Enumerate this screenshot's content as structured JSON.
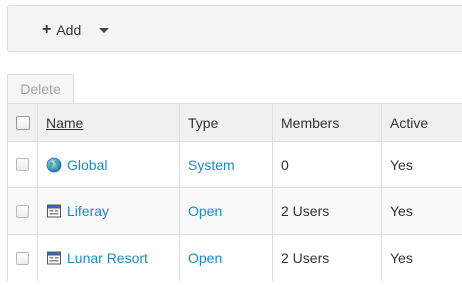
{
  "toolbar": {
    "add_label": "Add"
  },
  "actions": {
    "delete_label": "Delete"
  },
  "table": {
    "headers": {
      "name": "Name",
      "type": "Type",
      "members": "Members",
      "active": "Active"
    },
    "rows": [
      {
        "name": "Global",
        "icon": "globe-icon",
        "type": "System",
        "members": "0",
        "active": "Yes"
      },
      {
        "name": "Liferay",
        "icon": "site-icon",
        "type": "Open",
        "members": "2 Users",
        "active": "Yes"
      },
      {
        "name": "Lunar Resort",
        "icon": "site-icon",
        "type": "Open",
        "members": "2 Users",
        "active": "Yes"
      }
    ]
  },
  "colors": {
    "link": "#1b8bc8",
    "header_bg": "#f0f0f0",
    "border": "#dddddd"
  }
}
